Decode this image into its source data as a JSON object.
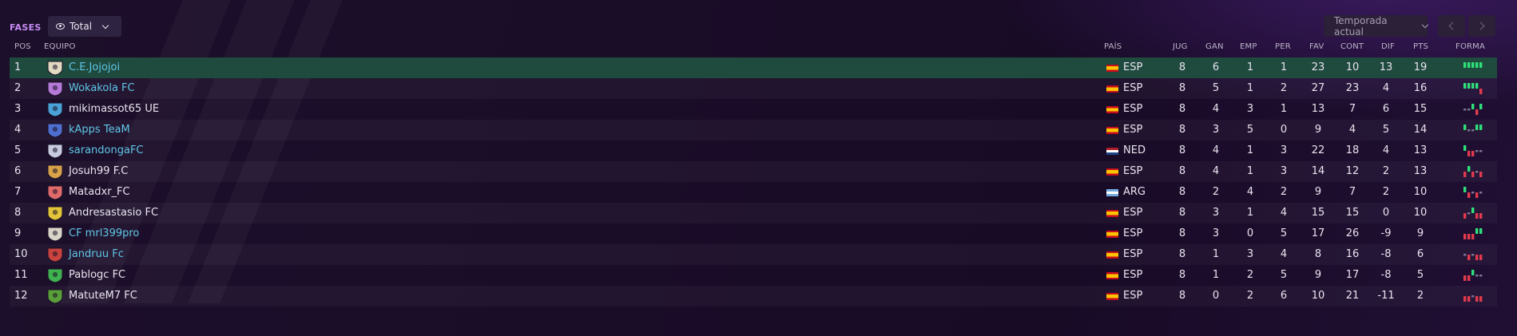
{
  "header": {
    "phase_label": "FASES",
    "filter_label": "Total",
    "season_label": "Temporada actual"
  },
  "columns": {
    "pos": "POS",
    "team": "EQUIPO",
    "country": "PAÍS",
    "played": "JUG",
    "won": "GAN",
    "drawn": "EMP",
    "lost": "PER",
    "goals_for": "FAV",
    "goals_against": "CONT",
    "goal_diff": "DIF",
    "points": "PTS",
    "form": "FORMA"
  },
  "colors": {
    "win": "#2fe07a",
    "draw": "#7d7590",
    "loss": "#e23a4d",
    "highlight_row": "#1f4a3e",
    "link": "#5fc6e6"
  },
  "rows": [
    {
      "pos": "1",
      "team": "C.E.Jojojoi",
      "link": true,
      "badge_color": "#e2d9c3",
      "country": "ESP",
      "flag": "esp",
      "played": "8",
      "won": "6",
      "drawn": "1",
      "lost": "1",
      "gf": "23",
      "ga": "10",
      "dif": "13",
      "pts": "19",
      "form": [
        "W",
        "W",
        "W",
        "W",
        "W"
      ],
      "highlight": true
    },
    {
      "pos": "2",
      "team": "Wokakola FC",
      "link": true,
      "badge_color": "#b57ad8",
      "country": "ESP",
      "flag": "esp",
      "played": "8",
      "won": "5",
      "drawn": "1",
      "lost": "2",
      "gf": "27",
      "ga": "23",
      "dif": "4",
      "pts": "16",
      "form": [
        "W",
        "W",
        "W",
        "W",
        "L"
      ]
    },
    {
      "pos": "3",
      "team": "mikimassot65 UE",
      "link": false,
      "badge_color": "#4aa3d8",
      "country": "ESP",
      "flag": "esp",
      "played": "8",
      "won": "4",
      "drawn": "3",
      "lost": "1",
      "gf": "13",
      "ga": "7",
      "dif": "6",
      "pts": "15",
      "form": [
        "D",
        "D",
        "W",
        "L",
        "W"
      ]
    },
    {
      "pos": "4",
      "team": "kApps TeaM",
      "link": true,
      "badge_color": "#4e6fd0",
      "country": "ESP",
      "flag": "esp",
      "played": "8",
      "won": "3",
      "drawn": "5",
      "lost": "0",
      "gf": "9",
      "ga": "4",
      "dif": "5",
      "pts": "14",
      "form": [
        "W",
        "D",
        "D",
        "W",
        "W"
      ]
    },
    {
      "pos": "5",
      "team": "sarandongaFC",
      "link": true,
      "badge_color": "#c8cbe0",
      "country": "NED",
      "flag": "ned",
      "played": "8",
      "won": "4",
      "drawn": "1",
      "lost": "3",
      "gf": "22",
      "ga": "18",
      "dif": "4",
      "pts": "13",
      "form": [
        "W",
        "L",
        "L",
        "D",
        "D"
      ]
    },
    {
      "pos": "6",
      "team": "Josuh99 F.C",
      "link": false,
      "badge_color": "#d8a24a",
      "country": "ESP",
      "flag": "esp",
      "played": "8",
      "won": "4",
      "drawn": "1",
      "lost": "3",
      "gf": "14",
      "ga": "12",
      "dif": "2",
      "pts": "13",
      "form": [
        "L",
        "W",
        "L",
        "D",
        "L"
      ]
    },
    {
      "pos": "7",
      "team": "Matadxr_FC",
      "link": false,
      "badge_color": "#e06a6a",
      "country": "ARG",
      "flag": "arg",
      "played": "8",
      "won": "2",
      "drawn": "4",
      "lost": "2",
      "gf": "9",
      "ga": "7",
      "dif": "2",
      "pts": "10",
      "form": [
        "W",
        "L",
        "D",
        "L",
        "D"
      ]
    },
    {
      "pos": "8",
      "team": "Andresastasio FC",
      "link": false,
      "badge_color": "#e2c43a",
      "country": "ESP",
      "flag": "esp",
      "played": "8",
      "won": "3",
      "drawn": "1",
      "lost": "4",
      "gf": "15",
      "ga": "15",
      "dif": "0",
      "pts": "10",
      "form": [
        "L",
        "D",
        "W",
        "L",
        "L"
      ]
    },
    {
      "pos": "9",
      "team": "CF mrl399pro",
      "link": true,
      "badge_color": "#d9d4c8",
      "country": "ESP",
      "flag": "esp",
      "played": "8",
      "won": "3",
      "drawn": "0",
      "lost": "5",
      "gf": "17",
      "ga": "26",
      "dif": "-9",
      "pts": "9",
      "form": [
        "L",
        "L",
        "L",
        "W",
        "W"
      ]
    },
    {
      "pos": "10",
      "team": "Jandruu Fc",
      "link": true,
      "badge_color": "#c9433f",
      "country": "ESP",
      "flag": "esp",
      "played": "8",
      "won": "1",
      "drawn": "3",
      "lost": "4",
      "gf": "8",
      "ga": "16",
      "dif": "-8",
      "pts": "6",
      "form": [
        "D",
        "L",
        "D",
        "L",
        "L"
      ]
    },
    {
      "pos": "11",
      "team": "Pablogc FC",
      "link": false,
      "badge_color": "#3fb34f",
      "country": "ESP",
      "flag": "esp",
      "played": "8",
      "won": "1",
      "drawn": "2",
      "lost": "5",
      "gf": "9",
      "ga": "17",
      "dif": "-8",
      "pts": "5",
      "form": [
        "L",
        "L",
        "W",
        "D",
        "D"
      ]
    },
    {
      "pos": "12",
      "team": "MatuteM7 FC",
      "link": false,
      "badge_color": "#5aa03a",
      "country": "ESP",
      "flag": "esp",
      "played": "8",
      "won": "0",
      "drawn": "2",
      "lost": "6",
      "gf": "10",
      "ga": "21",
      "dif": "-11",
      "pts": "2",
      "form": [
        "L",
        "L",
        "D",
        "L",
        "L"
      ]
    }
  ]
}
